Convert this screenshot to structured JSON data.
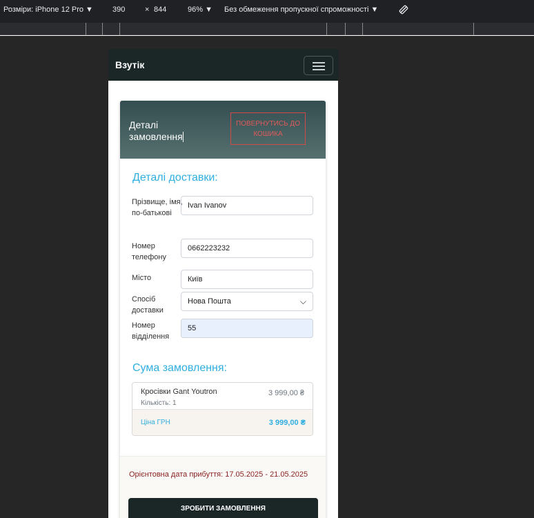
{
  "devtools": {
    "dimensions_label": "Розміри: iPhone 12 Pro ▼",
    "width": "390",
    "times": "×",
    "height": "844",
    "zoom": "96% ▼",
    "throttling": "Без обмеження пропускної спроможності ▼",
    "rotate_icon": "rotate-icon"
  },
  "navbar": {
    "brand": "Взутік",
    "toggler_icon": "hamburger-icon"
  },
  "header": {
    "title": "Деталі замовлення",
    "back_button": "ПОВЕРНУТИСЬ ДО КОШИКА"
  },
  "delivery": {
    "heading": "Деталі доставки:",
    "fields": [
      {
        "label": "Прізвище, імя, по-батькові",
        "value": "Ivan Ivanov"
      },
      {
        "label": "Номер телефону",
        "value": "0662223232"
      },
      {
        "label": "Місто",
        "value": "Київ"
      },
      {
        "label": "Спосіб доставки",
        "value": "Нова Пошта"
      },
      {
        "label": "Номер відділення",
        "value": "55"
      }
    ]
  },
  "summary": {
    "heading": "Сума замовлення:",
    "item": {
      "name": "Кросівки Gant Youtron",
      "qty": "Кількість: 1",
      "price": "3 999,00 ₴"
    },
    "total_label": "Ціна ГРН",
    "total_value": "3 999,00 ₴"
  },
  "footer": {
    "arrival": "Орієнтовна дата прибуття: 17.05.2025 - 21.05.2025",
    "order_button": "ЗРОБИТИ ЗАМОВЛЕННЯ"
  },
  "colors": {
    "navbar": "#1b2727",
    "accent": "#2faee0",
    "danger": "#d14b4b",
    "arrival": "#8a1f1f"
  }
}
